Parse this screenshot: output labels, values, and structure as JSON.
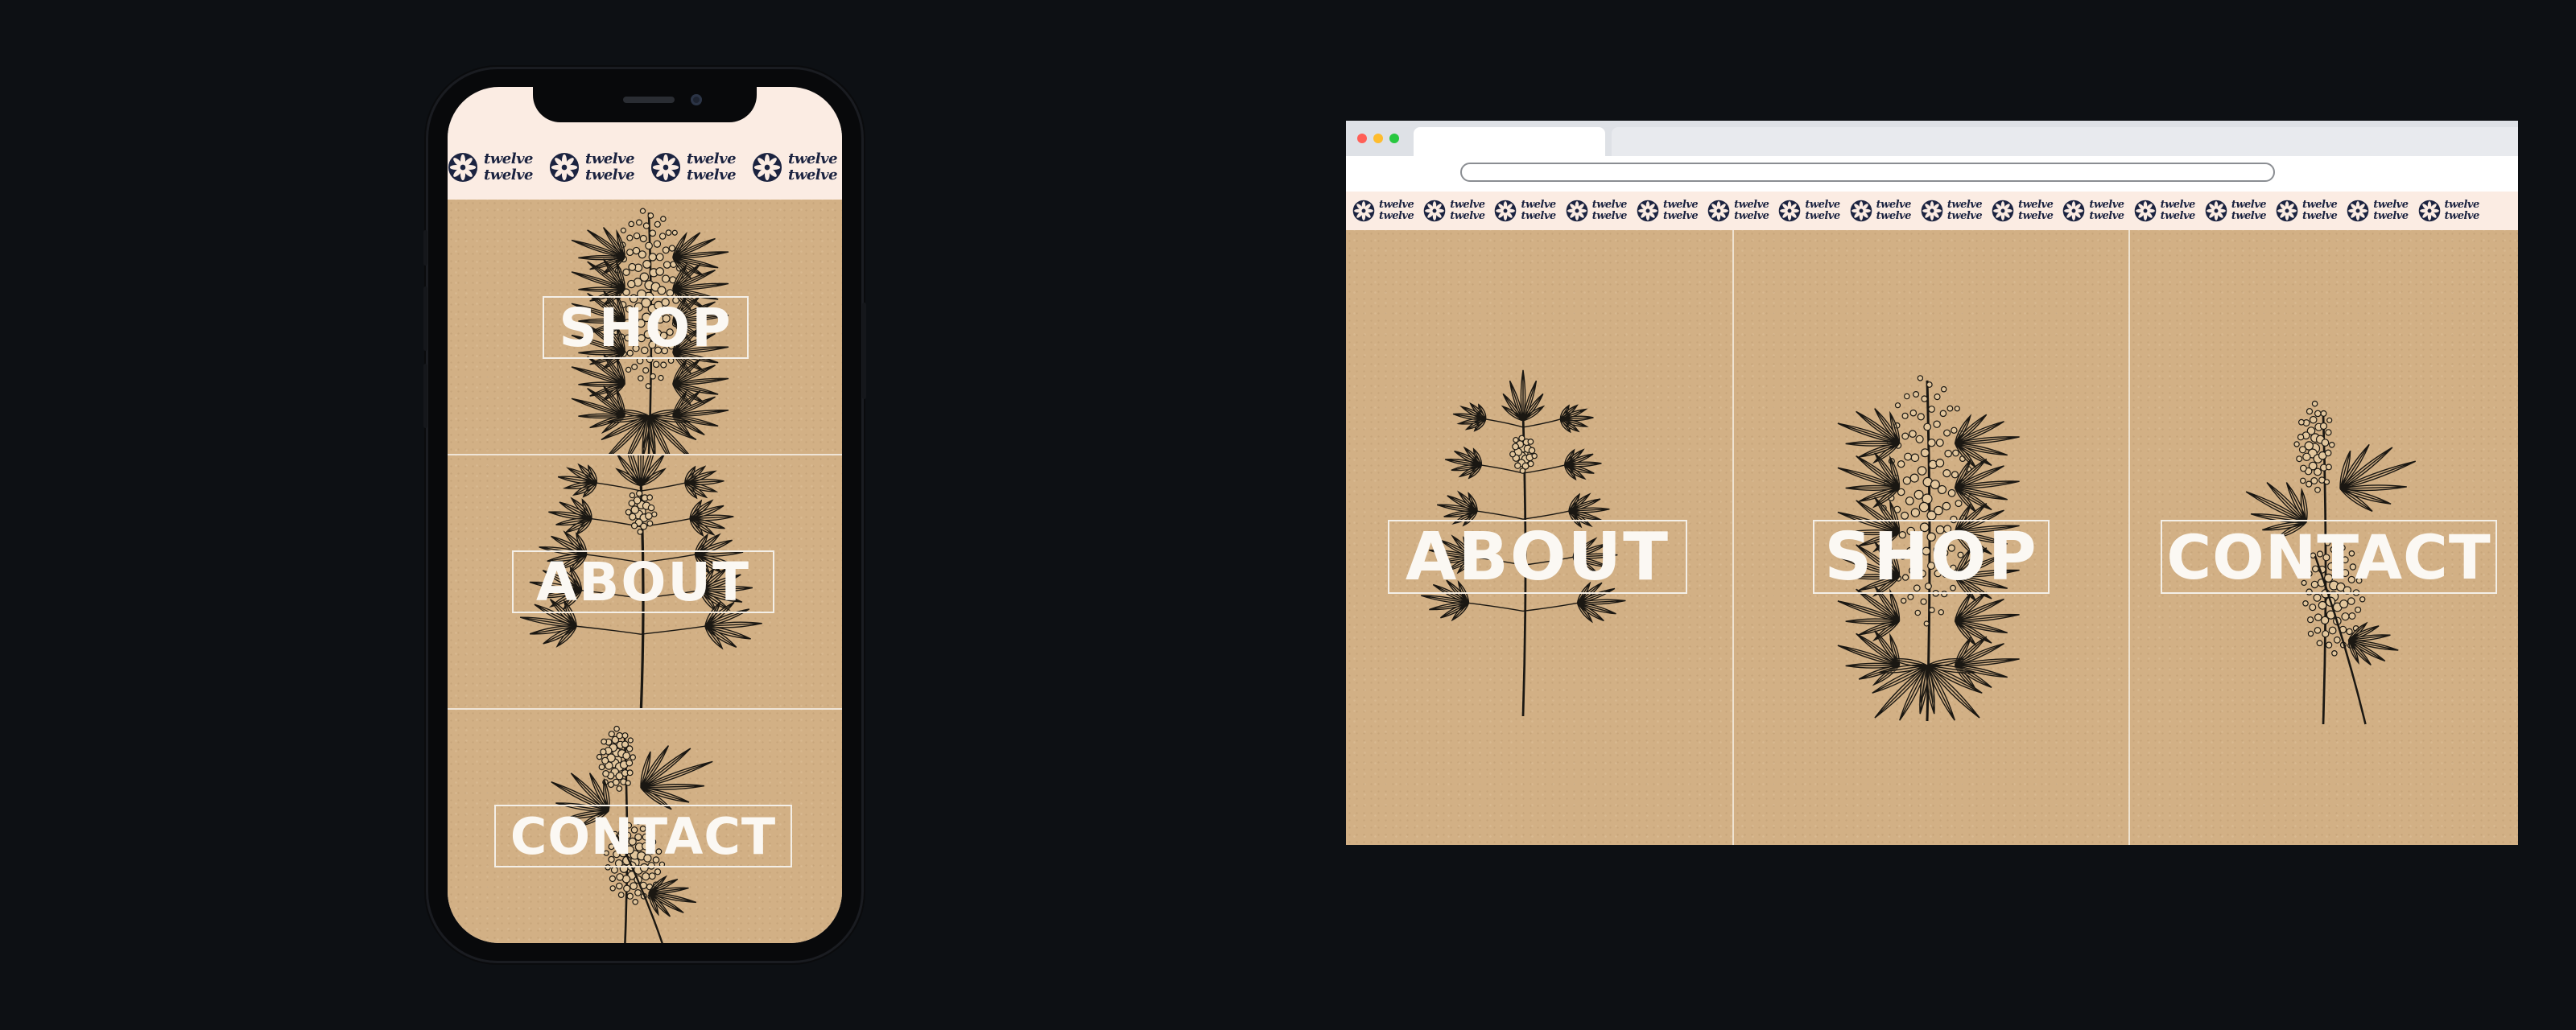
{
  "brand": {
    "wordmark_line1": "twelve",
    "wordmark_line2": "twelve",
    "icon": "flower-logo-icon",
    "color": "#1b2340",
    "ticker_background": "#fbece3"
  },
  "mobile": {
    "nav": [
      {
        "label": "SHOP",
        "illustration": "cannabis-bud-illustration"
      },
      {
        "label": "ABOUT",
        "illustration": "cannabis-plant-illustration"
      },
      {
        "label": "CONTACT",
        "illustration": "cannabis-flower-illustration"
      }
    ]
  },
  "desktop": {
    "window_controls": {
      "close": "#ff5f57",
      "minimize": "#febc2e",
      "maximize": "#28c840"
    },
    "address_bar_value": "",
    "nav": [
      {
        "label": "ABOUT",
        "illustration": "cannabis-plant-illustration"
      },
      {
        "label": "SHOP",
        "illustration": "cannabis-bud-illustration"
      },
      {
        "label": "CONTACT",
        "illustration": "cannabis-flower-illustration"
      }
    ]
  },
  "colors": {
    "page_background": "#0d1014",
    "kraft": "#d2b085",
    "label_text": "#fbf8f3",
    "ink": "#1a1712"
  }
}
